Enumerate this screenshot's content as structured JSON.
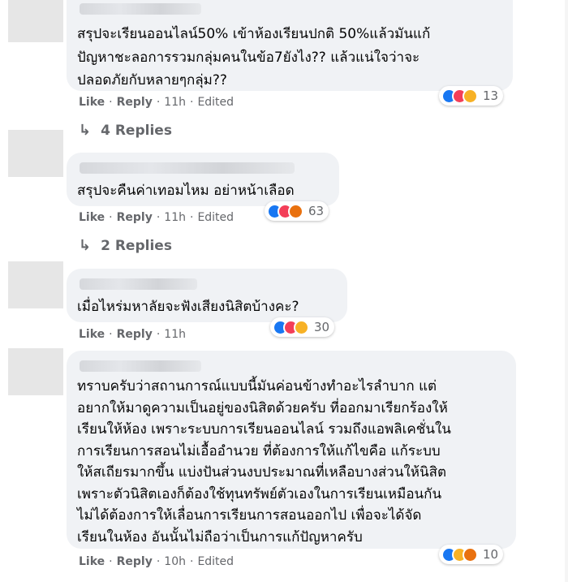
{
  "comments": [
    {
      "lines": [
        "สรุปจะเรียนออนไลน์50% เข้าห้องเรียนปกติ 50%แล้วมันแก้",
        "ปัญหาชะลอการรวมกลุ่มคนในข้อ7ยังไง?? แล้วแน่ใจว่าจะ",
        "ปลอดภัยกับหลายๆกลุ่ม??"
      ],
      "like": "Like",
      "reply": "Reply",
      "time": "11h",
      "edited": "Edited",
      "reaction_icons": [
        "like-icon",
        "love-icon",
        "haha-icon"
      ],
      "reaction_count": "13",
      "replies": "4 Replies"
    },
    {
      "lines": [
        "สรุปจะคืนค่าเทอมไหม อย่าหน้าเลือด"
      ],
      "like": "Like",
      "reply": "Reply",
      "time": "11h",
      "edited": "Edited",
      "reaction_icons": [
        "like-icon",
        "love-icon",
        "angry-icon"
      ],
      "reaction_count": "63",
      "replies": "2 Replies"
    },
    {
      "lines": [
        "เมื่อไหร่มหาลัยจะฟังเสียงนิสิตบ้างคะ?"
      ],
      "like": "Like",
      "reply": "Reply",
      "time": "11h",
      "reaction_icons": [
        "like-icon",
        "love-icon",
        "sad-icon"
      ],
      "reaction_count": "30"
    },
    {
      "lines": [
        "ทราบครับว่าสถานการณ์แบบนี้มันค่อนข้างทำอะไรลำบาก แต่",
        "อยากให้มาดูความเป็นอยู่ของนิสิตด้วยครับ ที่ออกมาเรียกร้องให้",
        "เรียนให้ห้อง เพราะระบบการเรียนออนไลน์ รวมถึงแอพลิเคชั่นใน",
        "การเรียนการสอนไม่เอื้ออำนวย ที่ต้องการให้แก้ไขคือ แก้ระบบ",
        "ให้สเถียรมากขึ้น แบ่งปันส่วนงบประมาณที่เหลือบางส่วนให้นิสิต",
        "เพราะตัวนิสิตเองก็ต้องใช้ทุนทรัพย์ตัวเองในการเรียนเหมือนกัน",
        "ไม่ได้ต้องการให้เลื่อนการเรียนการสอนออกไป เพื่อจะได้จัด",
        "เรียนในห้อง อันนั้นไม่ถือว่าเป็นการแก้ปัญหาครับ"
      ],
      "like": "Like",
      "reply": "Reply",
      "time": "10h",
      "edited": "Edited",
      "reaction_icons": [
        "like-icon",
        "sad-icon",
        "angry-icon"
      ],
      "reaction_count": "10"
    }
  ],
  "colors": {
    "bubble": "#f0f2f5",
    "secondary_text": "#65676b",
    "like": "#1877f2",
    "love": "#f33e58",
    "haha": "#f7b125",
    "angry": "#e9710f"
  }
}
